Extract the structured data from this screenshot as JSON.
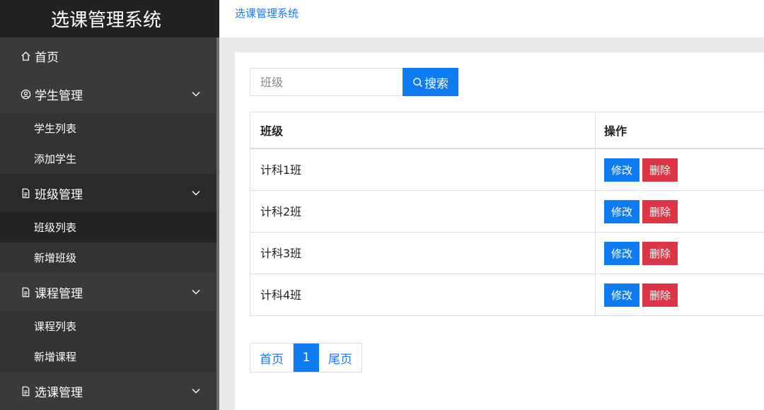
{
  "app": {
    "title": "选课管理系统"
  },
  "breadcrumb": "选课管理系统",
  "sidebar": {
    "home": {
      "label": "首页",
      "icon": "home-icon"
    },
    "groups": [
      {
        "label": "学生管理",
        "icon": "user-circle-icon",
        "items": [
          "学生列表",
          "添加学生"
        ]
      },
      {
        "label": "班级管理",
        "icon": "document-icon",
        "items": [
          "班级列表",
          "新增班级"
        ]
      },
      {
        "label": "课程管理",
        "icon": "document-icon",
        "items": [
          "课程列表",
          "新增课程"
        ]
      },
      {
        "label": "选课管理",
        "icon": "document-icon",
        "items": []
      }
    ]
  },
  "search": {
    "placeholder": "班级",
    "value": "",
    "button_label": "搜索"
  },
  "table": {
    "headers": [
      "班级",
      "操作"
    ],
    "rows": [
      {
        "name": "计科1班",
        "edit": "修改",
        "delete": "删除"
      },
      {
        "name": "计科2班",
        "edit": "修改",
        "delete": "删除"
      },
      {
        "name": "计科3班",
        "edit": "修改",
        "delete": "删除"
      },
      {
        "name": "计科4班",
        "edit": "修改",
        "delete": "删除"
      }
    ]
  },
  "pagination": {
    "first": "首页",
    "current": "1",
    "last": "尾页"
  },
  "colors": {
    "primary": "#0d7cf2",
    "danger": "#dc3545",
    "sidebar": "#3a3a3a",
    "brand_bg": "#222222"
  }
}
